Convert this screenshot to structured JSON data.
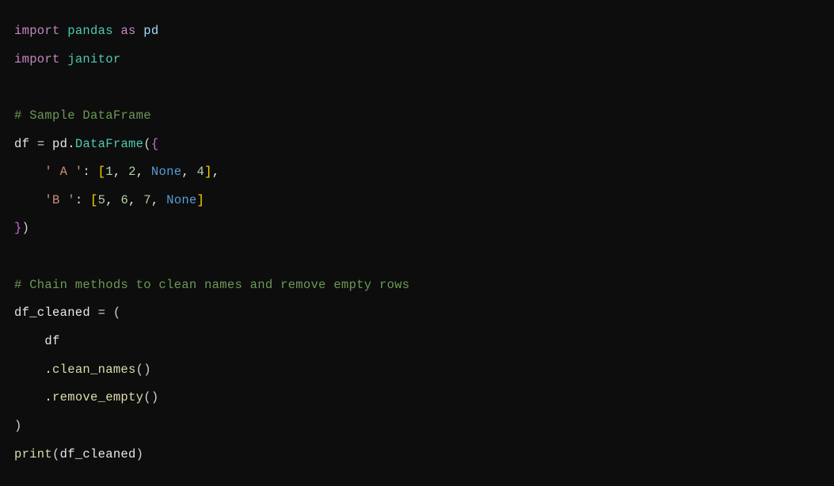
{
  "code": {
    "line1": {
      "import": "import",
      "module": "pandas",
      "as": "as",
      "alias": "pd"
    },
    "line2": {
      "import": "import",
      "module": "janitor"
    },
    "line4": {
      "comment": "# Sample DataFrame"
    },
    "line5": {
      "var": "df",
      "eq": "=",
      "alias": "pd",
      "dot": ".",
      "class": "DataFrame",
      "lparen": "(",
      "lbrace": "{"
    },
    "line6": {
      "indent": "    ",
      "key": "' A '",
      "colon": ":",
      "lbracket": "[",
      "v1": "1",
      "c1": ",",
      "v2": "2",
      "c2": ",",
      "v3": "None",
      "c3": ",",
      "v4": "4",
      "rbracket": "]",
      "comma": ","
    },
    "line7": {
      "indent": "    ",
      "key": "'B '",
      "colon": ":",
      "lbracket": "[",
      "v1": "5",
      "c1": ",",
      "v2": "6",
      "c2": ",",
      "v3": "7",
      "c3": ",",
      "v4": "None",
      "rbracket": "]"
    },
    "line8": {
      "rbrace": "}",
      "rparen": ")"
    },
    "line10": {
      "comment": "# Chain methods to clean names and remove empty rows"
    },
    "line11": {
      "var": "df_cleaned",
      "eq": "=",
      "lparen": "("
    },
    "line12": {
      "indent": "    ",
      "var": "df"
    },
    "line13": {
      "indent": "    ",
      "dot": ".",
      "method": "clean_names",
      "lparen": "(",
      "rparen": ")"
    },
    "line14": {
      "indent": "    ",
      "dot": ".",
      "method": "remove_empty",
      "lparen": "(",
      "rparen": ")"
    },
    "line15": {
      "rparen": ")"
    },
    "line16": {
      "func": "print",
      "lparen": "(",
      "arg": "df_cleaned",
      "rparen": ")"
    }
  }
}
